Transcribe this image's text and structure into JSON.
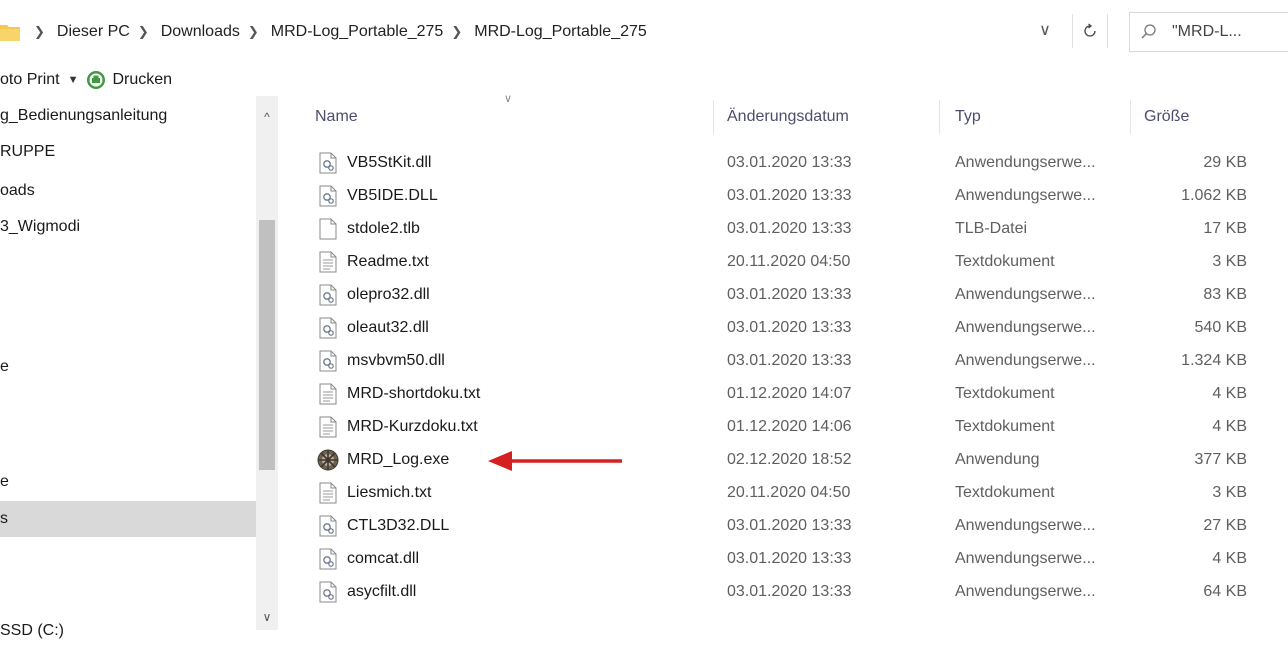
{
  "address": {
    "crumbs": [
      "Dieser PC",
      "Downloads",
      "MRD-Log_Portable_275",
      "MRD-Log_Portable_275"
    ],
    "search_text": "\"MRD-L..."
  },
  "toolbar": {
    "photo_print_label": "oto Print",
    "print_label": "Drucken"
  },
  "sidebar": {
    "items": [
      {
        "label": "g_Bedienungsanleitung"
      },
      {
        "label": "RUPPE"
      },
      {
        "label": "oads"
      },
      {
        "label": "3_Wigmodi"
      },
      {
        "label": "e"
      },
      {
        "label": "e"
      },
      {
        "label": "s"
      },
      {
        "label": "SSD (C:)"
      }
    ]
  },
  "columns": {
    "name": "Name",
    "date": "Änderungsdatum",
    "type": "Typ",
    "size": "Größe"
  },
  "files": [
    {
      "name": "VB5StKit.dll",
      "date": "03.01.2020 13:33",
      "type": "Anwendungserwe...",
      "size": "29 KB",
      "icon": "dll-icon"
    },
    {
      "name": "VB5IDE.DLL",
      "date": "03.01.2020 13:33",
      "type": "Anwendungserwe...",
      "size": "1.062 KB",
      "icon": "dll-icon"
    },
    {
      "name": "stdole2.tlb",
      "date": "03.01.2020 13:33",
      "type": "TLB-Datei",
      "size": "17 KB",
      "icon": "blank-file-icon"
    },
    {
      "name": "Readme.txt",
      "date": "20.11.2020 04:50",
      "type": "Textdokument",
      "size": "3 KB",
      "icon": "text-file-icon"
    },
    {
      "name": "olepro32.dll",
      "date": "03.01.2020 13:33",
      "type": "Anwendungserwe...",
      "size": "83 KB",
      "icon": "dll-icon"
    },
    {
      "name": "oleaut32.dll",
      "date": "03.01.2020 13:33",
      "type": "Anwendungserwe...",
      "size": "540 KB",
      "icon": "dll-icon"
    },
    {
      "name": "msvbvm50.dll",
      "date": "03.01.2020 13:33",
      "type": "Anwendungserwe...",
      "size": "1.324 KB",
      "icon": "dll-icon"
    },
    {
      "name": "MRD-shortdoku.txt",
      "date": "01.12.2020 14:07",
      "type": "Textdokument",
      "size": "4 KB",
      "icon": "text-file-icon"
    },
    {
      "name": "MRD-Kurzdoku.txt",
      "date": "01.12.2020 14:06",
      "type": "Textdokument",
      "size": "4 KB",
      "icon": "text-file-icon"
    },
    {
      "name": "MRD_Log.exe",
      "date": "02.12.2020 18:52",
      "type": "Anwendung",
      "size": "377 KB",
      "icon": "exe-app-icon"
    },
    {
      "name": "Liesmich.txt",
      "date": "20.11.2020 04:50",
      "type": "Textdokument",
      "size": "3 KB",
      "icon": "text-file-icon"
    },
    {
      "name": "CTL3D32.DLL",
      "date": "03.01.2020 13:33",
      "type": "Anwendungserwe...",
      "size": "27 KB",
      "icon": "dll-icon"
    },
    {
      "name": "comcat.dll",
      "date": "03.01.2020 13:33",
      "type": "Anwendungserwe...",
      "size": "4 KB",
      "icon": "dll-icon"
    },
    {
      "name": "asycfilt.dll",
      "date": "03.01.2020 13:33",
      "type": "Anwendungserwe...",
      "size": "64 KB",
      "icon": "dll-icon"
    }
  ],
  "colors": {
    "annotation_arrow": "#d42020",
    "selected_nav": "#d9d9d9",
    "folder": "#f3c94e"
  }
}
